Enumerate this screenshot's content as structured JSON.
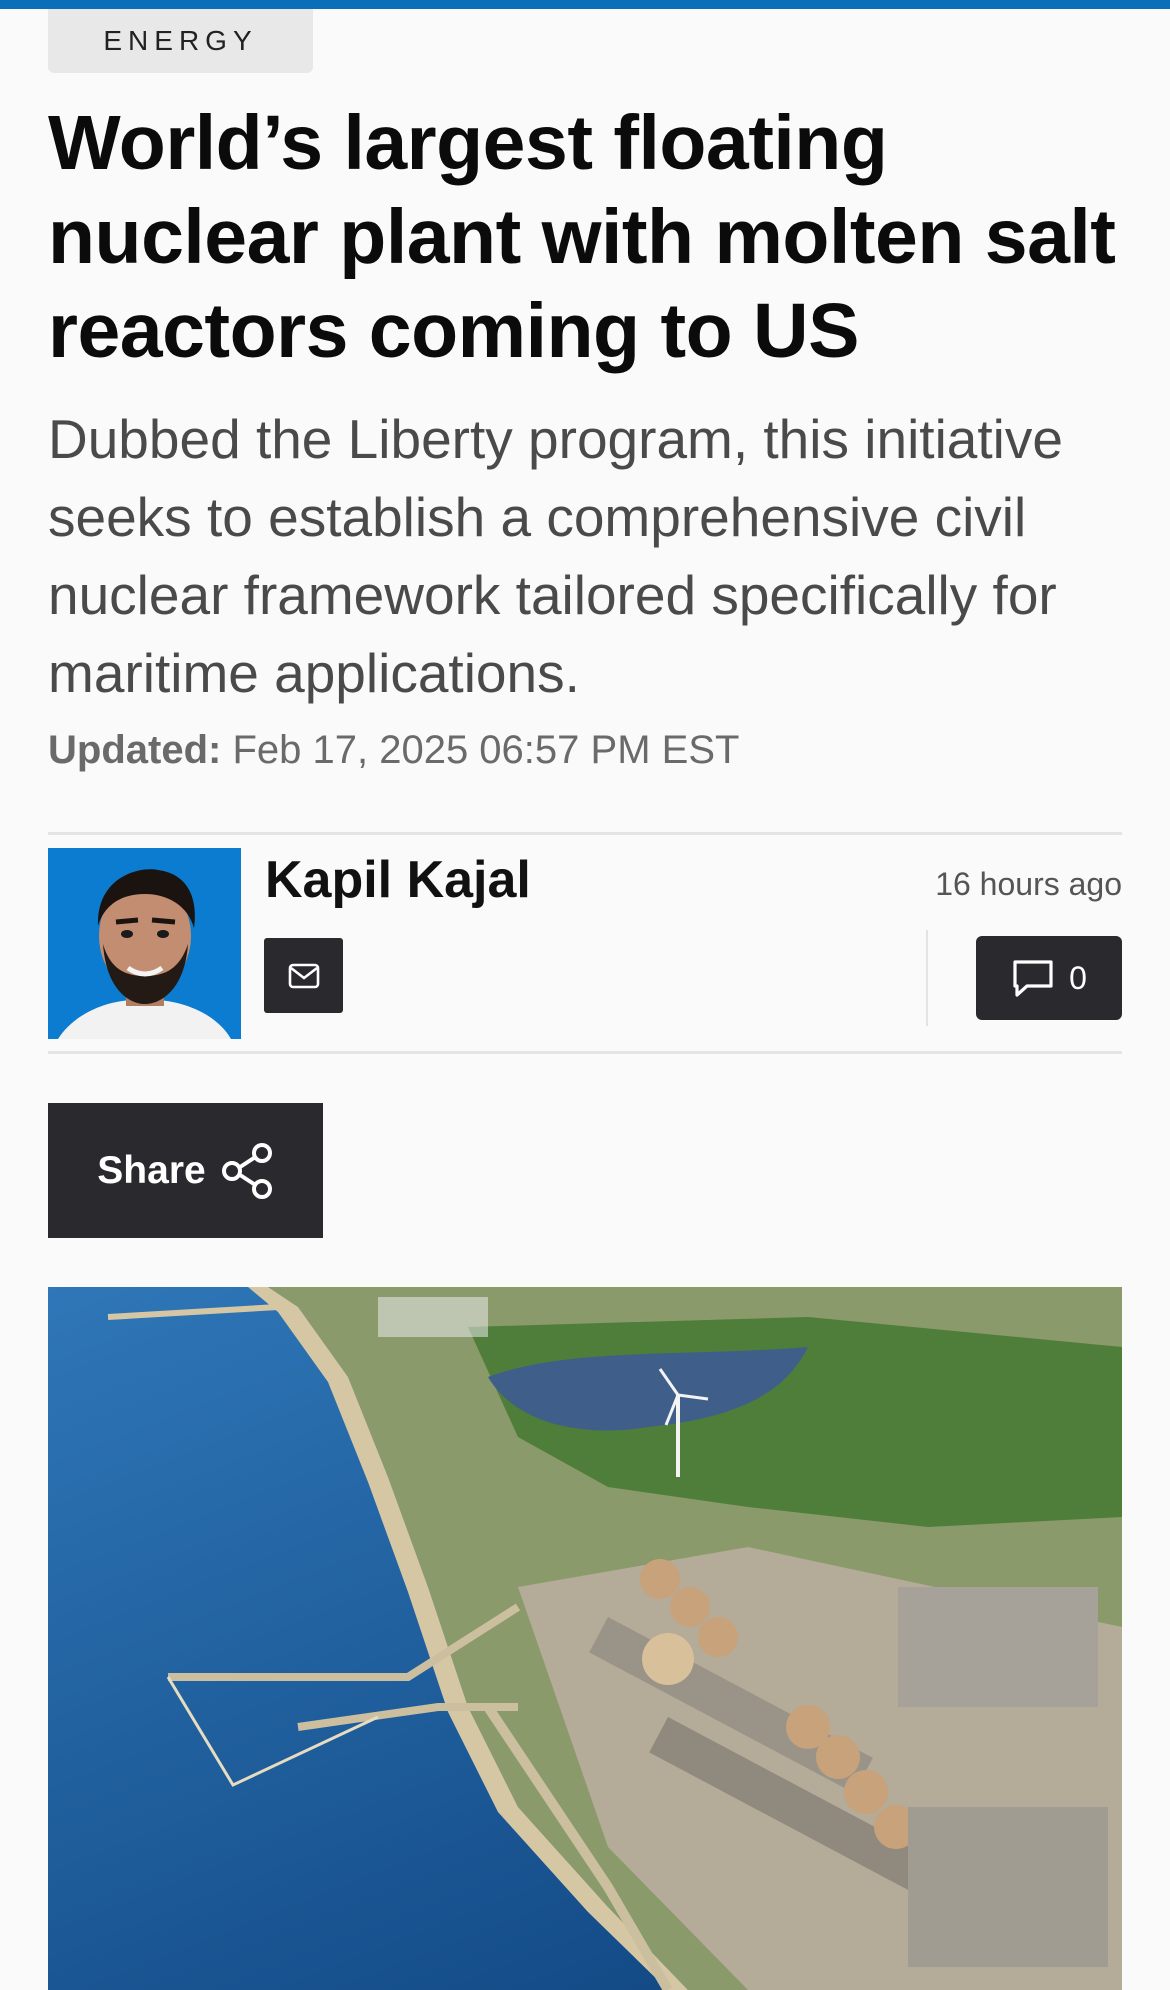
{
  "category": "ENERGY",
  "headline": "World’s largest floating nuclear plant with molten salt reactors coming to US",
  "dek": "Dubbed the Liberty program, this initiative seeks to establish a comprehensive civil nuclear framework tailored specifically for maritime applications.",
  "updated": {
    "label": "Updated:",
    "value": "Feb 17, 2025 06:57 PM EST"
  },
  "author": {
    "name": "Kapil Kajal",
    "posted": "16 hours ago"
  },
  "comments": {
    "count": "0"
  },
  "share": {
    "label": "Share"
  },
  "colors": {
    "accent_bar": "#0a6fb8",
    "button_dark": "#2a2a2e",
    "avatar_bg": "#0b7ccf"
  },
  "icons": [
    "mail-icon",
    "comment-icon",
    "share-icon"
  ]
}
